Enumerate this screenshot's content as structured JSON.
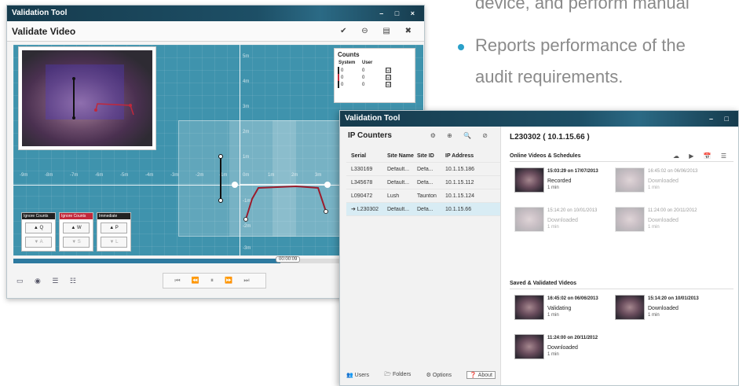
{
  "bullets": {
    "line1": "device, and perform manual",
    "line2": "Reports performance of the",
    "line3": "audit requirements."
  },
  "validate_window": {
    "app_title": "Validation Tool",
    "window_controls": "– □ ×",
    "heading": "Validate Video",
    "tools": "✔ ⊖ ▤ ✖",
    "counts": {
      "title": "Counts",
      "col_system": "System",
      "col_user": "User",
      "rows": [
        {
          "system": "0",
          "user": "0",
          "checked": "☑"
        },
        {
          "system": "0",
          "user": "0",
          "checked": "☑"
        },
        {
          "system": "0",
          "user": "0",
          "checked": "☑"
        }
      ]
    },
    "x_ticks": [
      "-9m",
      "-8m",
      "-7m",
      "-6m",
      "-5m",
      "-4m",
      "-3m",
      "-2m",
      "-1m",
      "0m",
      "1m",
      "2m",
      "3m"
    ],
    "y_ticks": [
      "5m",
      "4m",
      "3m",
      "2m",
      "1m",
      "-1m",
      "-2m",
      "-3m"
    ],
    "key_panels": [
      {
        "label": "Ignore Counts",
        "up": "▲ Q",
        "down": "▼ A"
      },
      {
        "label": "Ignore Counts",
        "up": "▲ W",
        "down": "▼ S"
      },
      {
        "label": "Immediate",
        "up": "▲ P",
        "down": "▼ L"
      }
    ],
    "time_marker": "00:00:09",
    "bottom_tools": "▭ ◉ ☰ ☷",
    "player_controls": "⏮ ⏪ ⏸ ⏩ ⏭"
  },
  "ip_window": {
    "app_title": "Validation Tool",
    "window_controls": "– □",
    "panel_title": "IP Counters",
    "panel_icons": "⚙ ⊕ 🔍 ⊘",
    "columns": [
      "Serial",
      "Site Name",
      "Site ID",
      "IP Address"
    ],
    "rows": [
      {
        "serial": "L330169",
        "site": "Default...",
        "id": "Defa...",
        "ip": "10.1.15.186"
      },
      {
        "serial": "L345678",
        "site": "Default...",
        "id": "Defa...",
        "ip": "10.1.15.112"
      },
      {
        "serial": "L090472",
        "site": "Lush",
        "id": "Taunton",
        "ip": "10.1.15.124"
      },
      {
        "serial": "➔ L230302",
        "site": "Default...",
        "id": "Defa...",
        "ip": "10.1.15.66"
      }
    ],
    "nav": {
      "users": "👥 Users",
      "folders": "🗁 Folders",
      "options": "⚙ Options",
      "about": "❓ About"
    },
    "device_title": "L230302 ( 10.1.15.66 )",
    "online_section": "Online Videos & Schedules",
    "online_icons": "☁ ▶ 📅 ☰",
    "online_tiles": [
      {
        "time": "15:03:29 on 17/07/2013",
        "status": "Recorded",
        "dur": "1 min",
        "faded": false
      },
      {
        "time": "16:45:02 on 06/06/2013",
        "status": "Downloaded",
        "dur": "1 min",
        "faded": true
      },
      {
        "time": "15:14:20 on 10/01/2013",
        "status": "Downloaded",
        "dur": "1 min",
        "faded": true
      },
      {
        "time": "11:24:00 on 20/11/2012",
        "status": "Downloaded",
        "dur": "1 min",
        "faded": true
      }
    ],
    "saved_section": "Saved & Validated Videos",
    "saved_tiles": [
      {
        "time": "16:45:02 on 06/06/2013",
        "status": "Validating",
        "dur": "1 min"
      },
      {
        "time": "15:14:20 on 10/01/2013",
        "status": "Downloaded",
        "dur": "1 min"
      },
      {
        "time": "11:24:00 on 20/11/2012",
        "status": "Downloaded",
        "dur": "1 min"
      }
    ]
  }
}
